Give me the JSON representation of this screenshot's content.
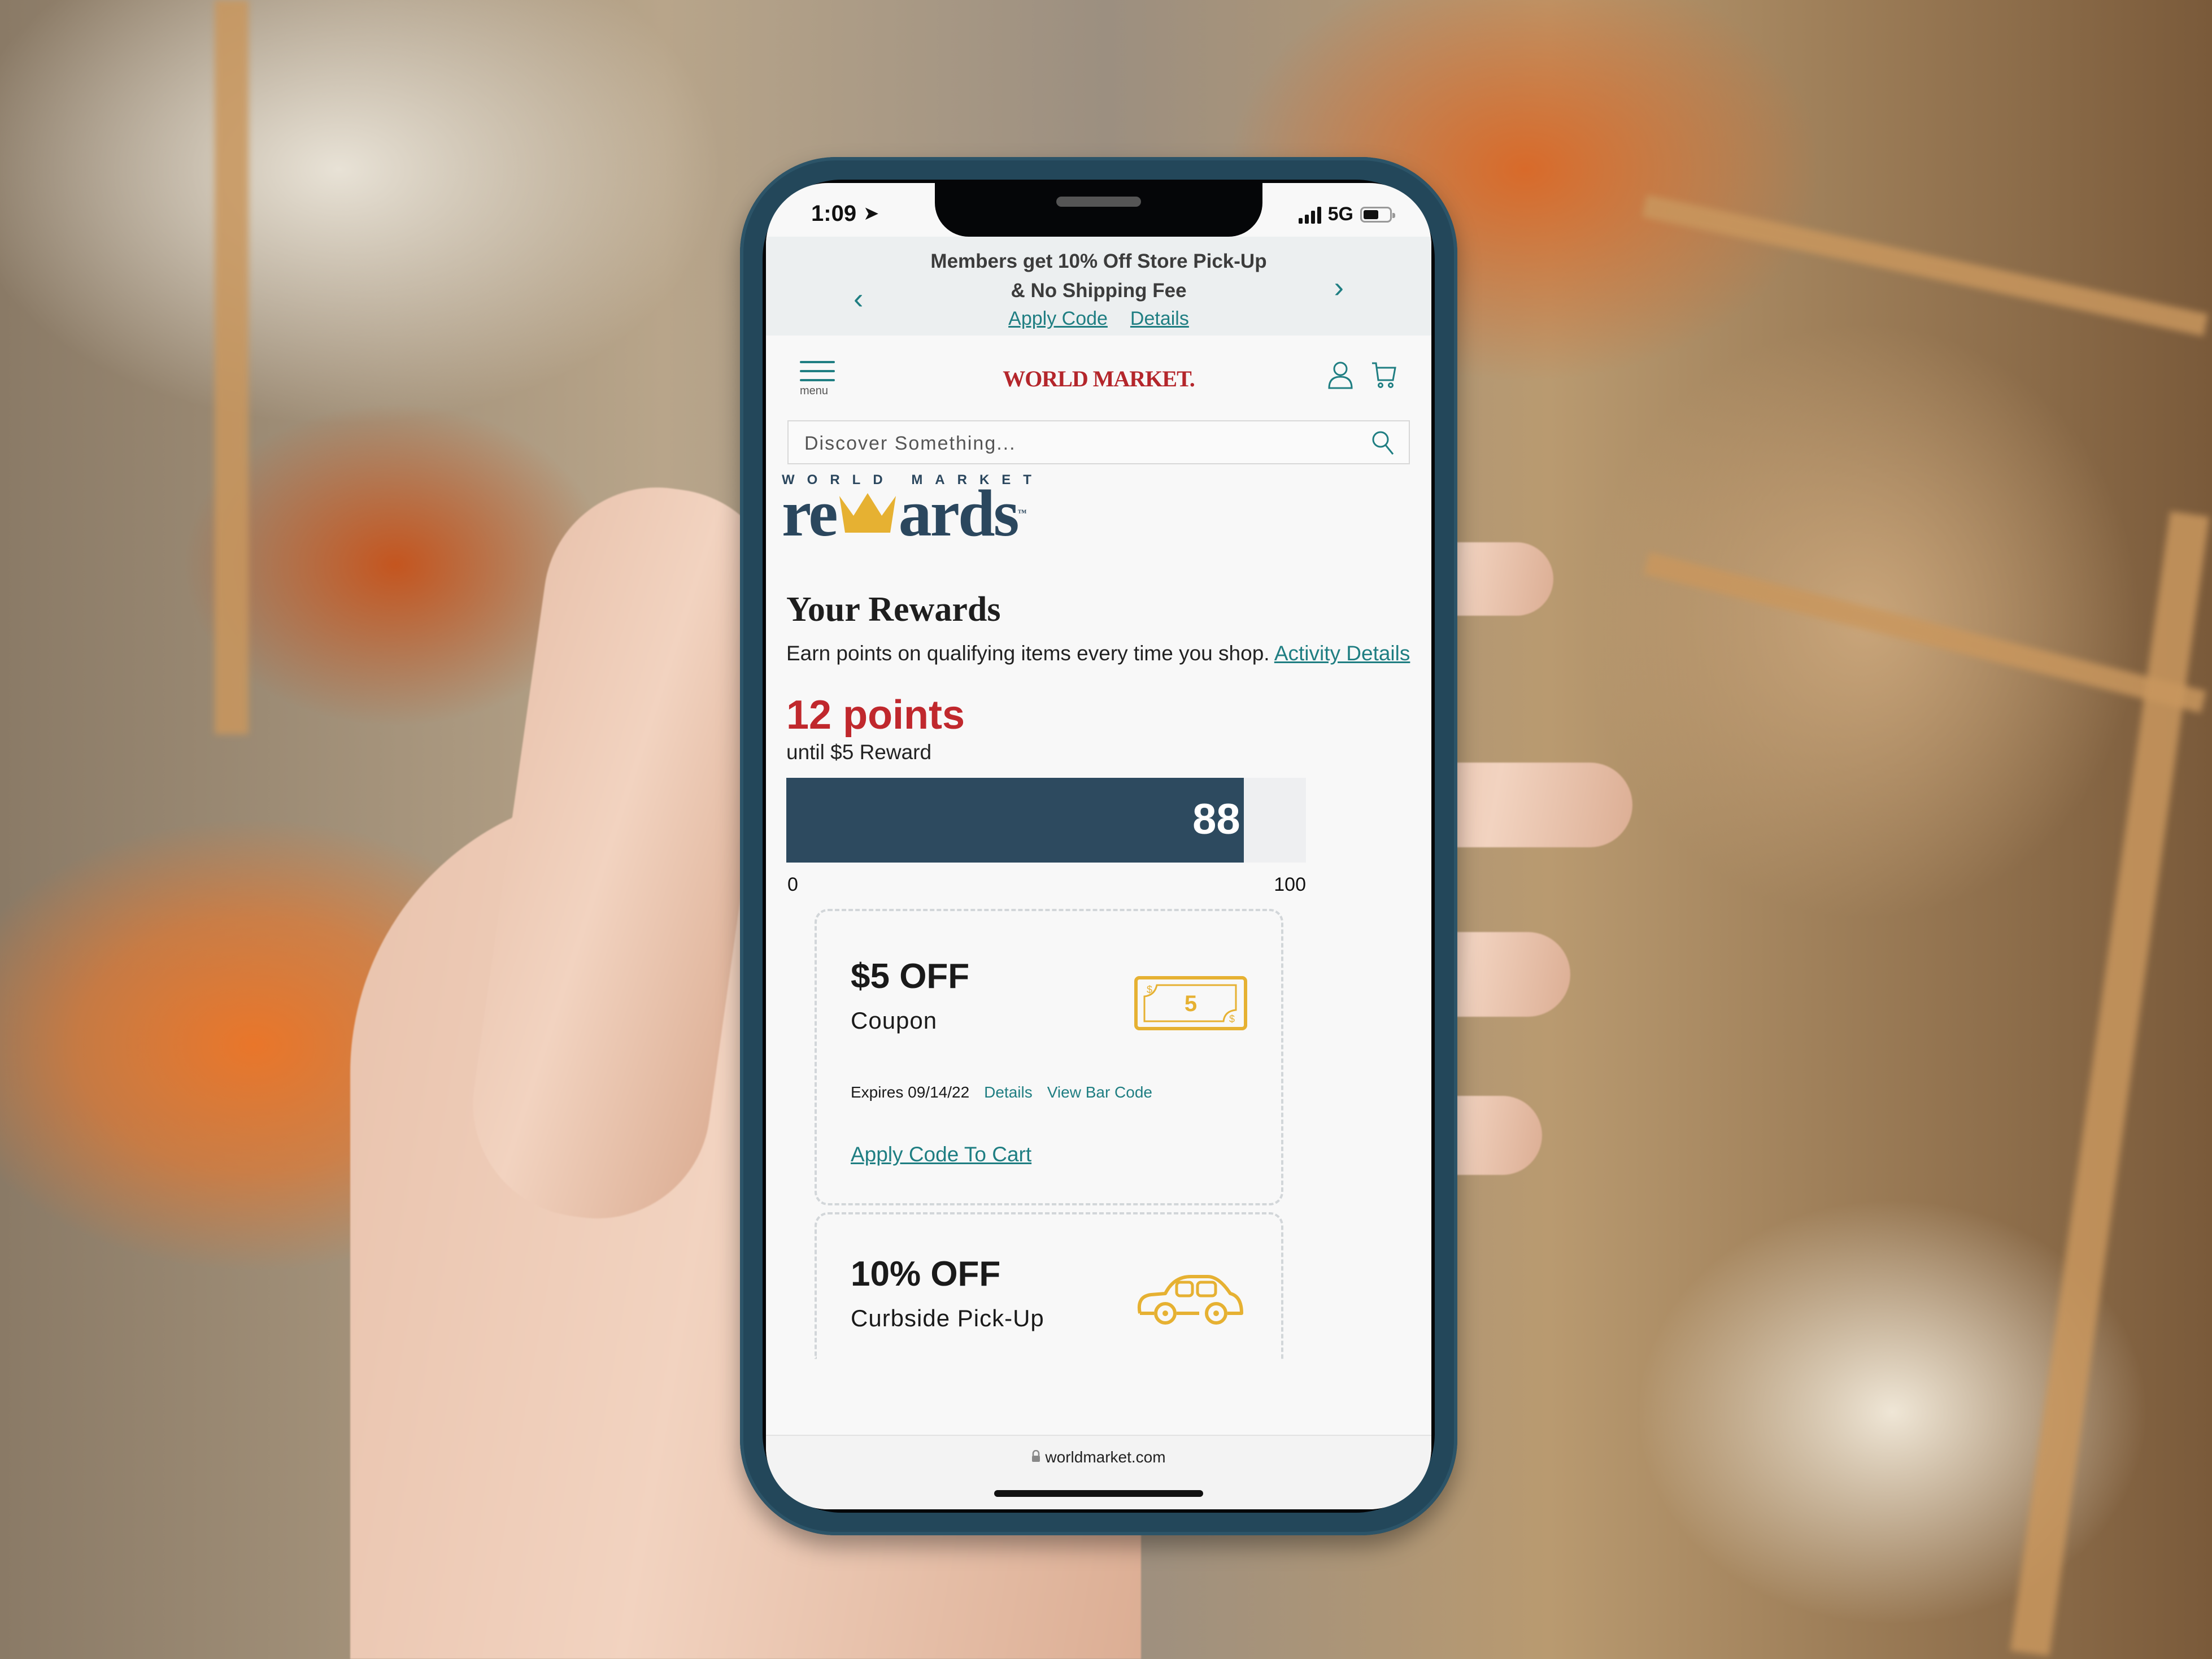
{
  "status_bar": {
    "time": "1:09",
    "network": "5G",
    "battery_level": 0.6
  },
  "promo_banner": {
    "line1": "Members get 10% Off Store Pick-Up",
    "line2": "& No Shipping Fee",
    "apply_code": "Apply Code",
    "details": "Details",
    "prev_icon": "chevron-left-icon",
    "next_icon": "chevron-right-icon"
  },
  "header": {
    "menu_label": "menu",
    "logo_text": "WORLD MARKET.",
    "account_icon": "user-icon",
    "cart_icon": "cart-icon"
  },
  "search": {
    "placeholder": "Discover Something..."
  },
  "rewards_logo": {
    "top_text": "WORLD MARKET",
    "left_text": "re",
    "right_text": "ards",
    "tm": "™"
  },
  "rewards": {
    "title": "Your Rewards",
    "description": "Earn points on qualifying items every time you shop.",
    "activity_link": "Activity Details",
    "points_text": "12 points",
    "until_text": "until $5 Reward",
    "progress": {
      "value": 88,
      "min": 0,
      "max": 100,
      "value_label": "88",
      "min_label": "0",
      "max_label": "100"
    }
  },
  "coupons": [
    {
      "title": "$5 OFF",
      "subtitle": "Coupon",
      "expires": "Expires 09/14/22",
      "details": "Details",
      "view_bar_code": "View Bar Code",
      "apply": "Apply Code To Cart",
      "icon": "dollar-bill-icon",
      "icon_value": "5"
    },
    {
      "title": "10% OFF",
      "subtitle": "Curbside Pick-Up",
      "icon": "car-icon"
    }
  ],
  "browser": {
    "url": "worldmarket.com"
  },
  "colors": {
    "accent_teal": "#1f7e82",
    "brand_red": "#b4262b",
    "points_red": "#c0282d",
    "navy": "#2d4a5f",
    "gold": "#e6b132",
    "phone_case": "#23475a"
  }
}
